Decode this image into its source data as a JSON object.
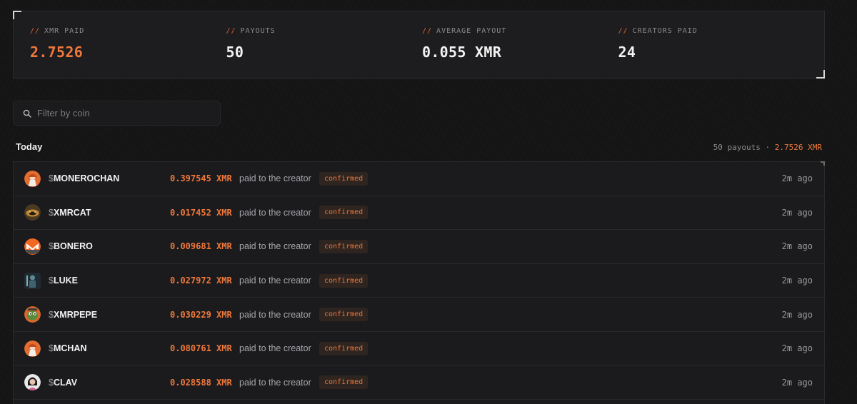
{
  "stats": [
    {
      "label": "XMR PAID",
      "value": "2.7526",
      "accent": true
    },
    {
      "label": "PAYOUTS",
      "value": "50",
      "accent": false
    },
    {
      "label": "AVERAGE PAYOUT",
      "value": "0.055 XMR",
      "accent": false
    },
    {
      "label": "CREATORS PAID",
      "value": "24",
      "accent": false
    }
  ],
  "stat_prefix": "//",
  "filter": {
    "placeholder": "Filter by coin",
    "value": ""
  },
  "section": {
    "title": "Today",
    "payouts_count": "50 payouts",
    "separator": "·",
    "total": "2.7526 XMR"
  },
  "payouts": [
    {
      "ticker": "MONEROCHAN",
      "amount": "0.397545 XMR",
      "desc": "paid to the creator",
      "status": "confirmed",
      "time": "2m ago",
      "avatar": "anime-girl-icon"
    },
    {
      "ticker": "XMRCAT",
      "amount": "0.017452 XMR",
      "desc": "paid to the creator",
      "status": "confirmed",
      "time": "2m ago",
      "avatar": "cat-icon"
    },
    {
      "ticker": "BONERO",
      "amount": "0.009681 XMR",
      "desc": "paid to the creator",
      "status": "confirmed",
      "time": "2m ago",
      "avatar": "monero-logo-icon"
    },
    {
      "ticker": "LUKE",
      "amount": "0.027972 XMR",
      "desc": "paid to the creator",
      "status": "confirmed",
      "time": "2m ago",
      "avatar": "figure-icon"
    },
    {
      "ticker": "XMRPEPE",
      "amount": "0.030229 XMR",
      "desc": "paid to the creator",
      "status": "confirmed",
      "time": "2m ago",
      "avatar": "pepe-icon"
    },
    {
      "ticker": "MCHAN",
      "amount": "0.080761 XMR",
      "desc": "paid to the creator",
      "status": "confirmed",
      "time": "2m ago",
      "avatar": "anime-girl-icon"
    },
    {
      "ticker": "CLAV",
      "amount": "0.028588 XMR",
      "desc": "paid to the creator",
      "status": "confirmed",
      "time": "2m ago",
      "avatar": "portrait-icon"
    }
  ],
  "colors": {
    "accent": "#f0783a",
    "background": "#151515",
    "panel": "#1d1c1f"
  }
}
